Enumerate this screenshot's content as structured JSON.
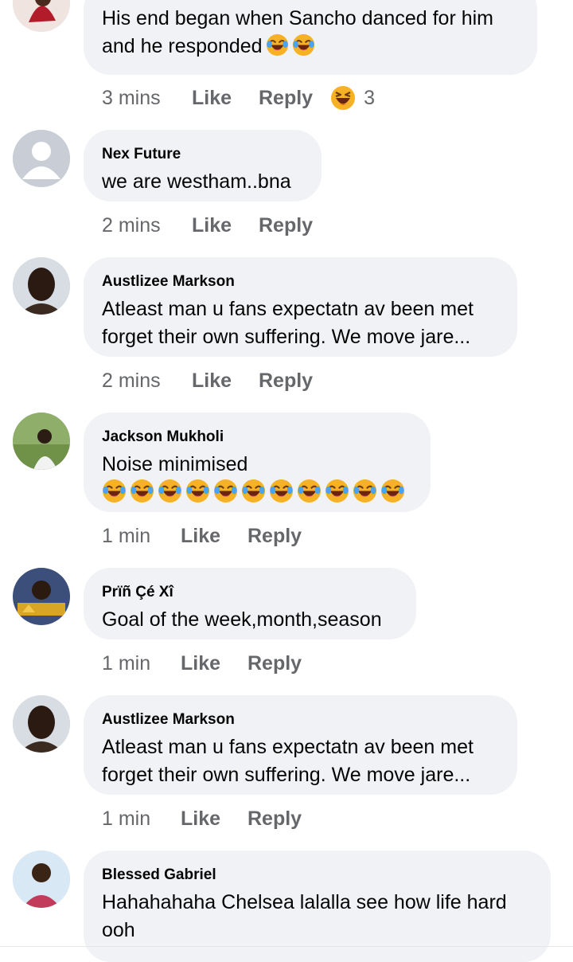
{
  "comments": [
    {
      "name": "",
      "lines": [
        "His end began when Sancho danced for him",
        "and he responded"
      ],
      "line2_emojis": 2,
      "time": "3 mins",
      "like": "Like",
      "reply": "Reply",
      "reaction": {
        "icon": "laugh-emoji-icon",
        "count": "3"
      }
    },
    {
      "name": "Nex Future",
      "lines": [
        "we are westham..bna"
      ],
      "time": "2 mins",
      "like": "Like",
      "reply": "Reply"
    },
    {
      "name": "Austlizee Markson",
      "lines": [
        "Atleast man u fans expectatn av been met",
        "forget their own suffering. We move jare..."
      ],
      "time": "2 mins",
      "like": "Like",
      "reply": "Reply"
    },
    {
      "name": "Jackson Mukholi",
      "lines": [
        "Noise minimised"
      ],
      "emoji_row_count": 11,
      "time": "1 min",
      "like": "Like",
      "reply": "Reply"
    },
    {
      "name": "Prïñ Çé Xî",
      "lines": [
        "Goal of the week,month,season"
      ],
      "time": "1 min",
      "like": "Like",
      "reply": "Reply"
    },
    {
      "name": "Austlizee Markson",
      "lines": [
        "Atleast man u fans expectatn av been met",
        "forget their own suffering. We move jare..."
      ],
      "time": "1 min",
      "like": "Like",
      "reply": "Reply"
    },
    {
      "name": "Blessed Gabriel",
      "lines": [
        "Hahahahaha Chelsea lalalla see how life hard",
        "ooh"
      ]
    }
  ],
  "colors": {
    "bubble": "#f0f2f5",
    "meta": "#65676b",
    "text": "#050505",
    "emoji": "#f7b125"
  }
}
